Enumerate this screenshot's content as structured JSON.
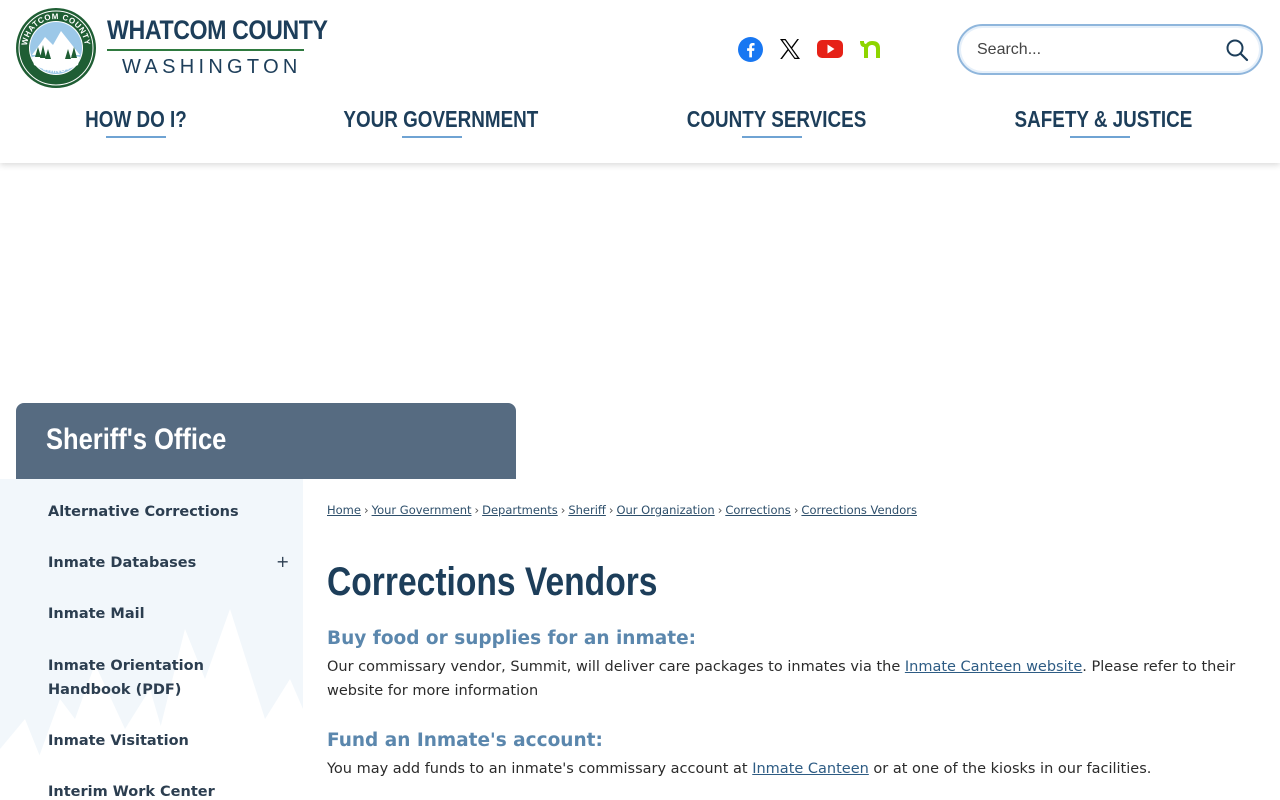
{
  "header": {
    "brand_title": "WHATCOM COUNTY",
    "brand_sub": "WASHINGTON",
    "seal_top": "WHATCOM COUNTY",
    "seal_bottom": "WASHINGTON",
    "social": [
      {
        "name": "facebook-icon",
        "color": "#1877f2"
      },
      {
        "name": "x-icon",
        "color": "#000000"
      },
      {
        "name": "youtube-icon",
        "color": "#e62117"
      },
      {
        "name": "nextdoor-icon",
        "color": "#8ed500"
      }
    ],
    "search_placeholder": "Search..."
  },
  "nav": {
    "items": [
      {
        "label": "HOW DO I?"
      },
      {
        "label": "YOUR GOVERNMENT"
      },
      {
        "label": "COUNTY SERVICES"
      },
      {
        "label": "SAFETY & JUSTICE"
      }
    ]
  },
  "banner": {
    "title": "Sheriff's Office"
  },
  "sidebar": {
    "items": [
      {
        "label": "Alternative Corrections"
      },
      {
        "label": "Inmate Databases",
        "expand": "+"
      },
      {
        "label": "Inmate Mail"
      },
      {
        "label": "Inmate Orientation Handbook (PDF)"
      },
      {
        "label": "Inmate Visitation"
      },
      {
        "label": "Interim Work Center"
      }
    ]
  },
  "breadcrumb": {
    "separator": "›",
    "items": [
      "Home",
      "Your Government",
      "Departments",
      "Sheriff",
      "Our Organization",
      "Corrections",
      "Corrections Vendors"
    ]
  },
  "content": {
    "title": "Corrections Vendors",
    "section1": {
      "heading": "Buy food or supplies for an inmate:",
      "text_before": "Our commissary vendor, Summit, will deliver care packages to inmates via the ",
      "link": "Inmate Canteen website",
      "text_after": ". Please refer to their website for more information"
    },
    "section2": {
      "heading": "Fund an Inmate's account:",
      "text_before": "You may add funds to an inmate's commissary account at ",
      "link": "Inmate Canteen",
      "text_after": " or at one of the kiosks in our facilities."
    }
  },
  "colors": {
    "brand": "#1d3e5a",
    "banner": "#566b81",
    "accent": "#6fa3d3",
    "subheading": "#5b87ad",
    "seal_green": "#2f7a3f"
  }
}
